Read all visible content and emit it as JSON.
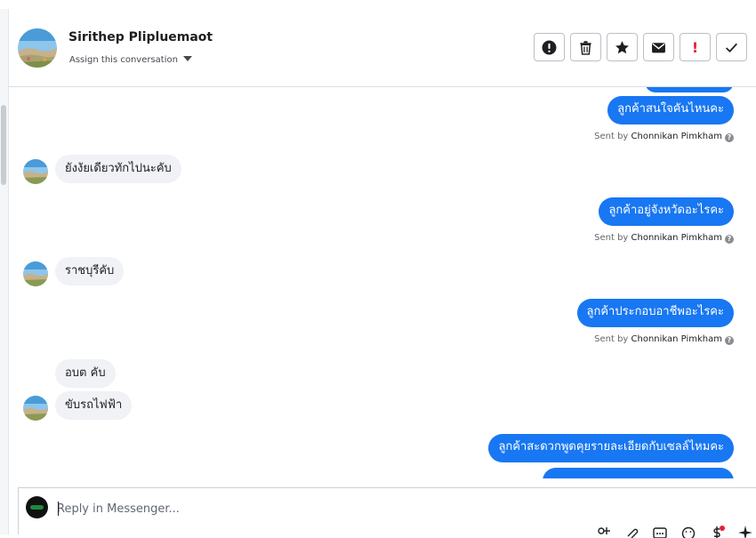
{
  "contact": {
    "name": "Sirithep Plipluemaot",
    "assign_label": "Assign this conversation"
  },
  "actions": [
    {
      "name": "report-button",
      "icon": "alert-circle-icon"
    },
    {
      "name": "delete-button",
      "icon": "trash-icon"
    },
    {
      "name": "star-button",
      "icon": "star-icon"
    },
    {
      "name": "mark-unread-button",
      "icon": "envelope-icon"
    },
    {
      "name": "flag-button",
      "icon": "exclamation-icon",
      "glyph": "!"
    },
    {
      "name": "mark-done-button",
      "icon": "check-icon"
    }
  ],
  "messages": {
    "m1": "ลูกค้าสนใจคันไหนคะ",
    "m3": "ยังงัยเดียวทักไปนะคับ",
    "m4": "ลูกค้าอยู่จังหวัดอะไรคะ",
    "m5": "ราชบุรีคับ",
    "m6": "ลูกค้าประกอบอาชีพอะไรคะ",
    "m7": "อบต คับ",
    "m8": "ขับรถไฟฟ้า",
    "m9": "ลูกค้าสะดวกพูดคุยรายละเอียดกับเซลล์ไหมคะ"
  },
  "sent_by": {
    "prefix": "Sent by",
    "agent": "Chonnikan Pimkham",
    "help_glyph": "?"
  },
  "composer": {
    "placeholder": "Reply in Messenger..."
  },
  "composer_tools": [
    "add-icon",
    "attachment-icon",
    "saved-reply-icon",
    "emoji-icon",
    "payment-icon",
    "sparkle-icon"
  ],
  "colors": {
    "outgoing_bubble": "#1877f2",
    "incoming_bubble": "#f0f2f5",
    "flag": "#e41e3f"
  }
}
